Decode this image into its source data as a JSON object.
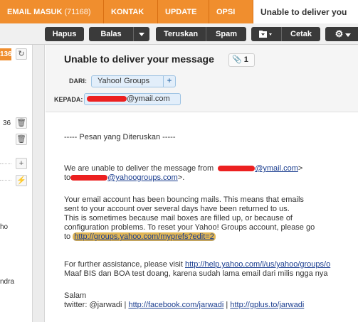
{
  "tabs": [
    {
      "label": "EMAIL MASUK",
      "count": "(71168)"
    },
    {
      "label": "KONTAK"
    },
    {
      "label": "UPDATE"
    },
    {
      "label": "OPSI"
    },
    {
      "label": "Unable to deliver you"
    }
  ],
  "toolbar": {
    "hapus": "Hapus",
    "balas": "Balas",
    "teruskan": "Teruskan",
    "spam": "Spam",
    "cetak": "Cetak"
  },
  "left": {
    "badge": "136",
    "count": "36",
    "snippets": [
      "ho",
      "ndra"
    ]
  },
  "message": {
    "subject": "Unable to deliver your message",
    "attachment_count": "1",
    "from_label": "DARI:",
    "from_value": "Yahoo! Groups",
    "to_label": "KEPADA:",
    "to_value_suffix": "@ymail.com"
  },
  "body": {
    "forward_line": "----- Pesan yang Diteruskan -----",
    "line1a": "We are unable to deliver the message from",
    "line1_link": "@ymail.com",
    "line1b": ">",
    "line2a": "to",
    "line2_link": "@yahoogroups.com",
    "line2b": ">.",
    "para2": [
      "Your email account has been bouncing mails.  This means that emails",
      "sent to your account over several days have been returned to us.",
      "This is sometimes because mail boxes are filled up, or because of",
      "configuration problems.  To reset your Yahoo! Groups account, please go",
      "to"
    ],
    "reset_link": "http://groups.yahoo.com/myprefs?edit=2",
    "assist_text": "For further assistance, please visit",
    "assist_link": "http://help.yahoo.com/l/us/yahoo/groups/o",
    "maaf": "Maaf BIS dan BOA test doang, karena sudah lama email dari milis ngga nya",
    "salam": "Salam",
    "twitter": "twitter: @jarwadi |",
    "fb_link": "http://facebook.com/jarwadi",
    "sep": "|",
    "gplus_link": "http://gplus.to/jarwadi"
  },
  "colors": {
    "accent": "#f08e2e",
    "redaction": "#ec2020",
    "highlight": "#e2b755",
    "link": "#1a3d8f"
  }
}
